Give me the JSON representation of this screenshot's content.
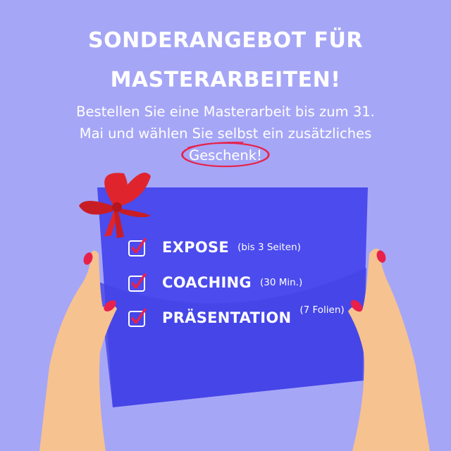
{
  "headline": {
    "line1": "SONDERANGEBOT FÜR",
    "line2": "MASTERARBEITEN!"
  },
  "subline": {
    "line1": "Bestellen Sie eine Masterarbeit bis zum 31.",
    "line2": "Mai und wählen Sie selbst ein zusätzliches",
    "highlight": "Geschenk!"
  },
  "items": [
    {
      "title": "EXPOSE",
      "note": "(bis 3 Seiten)"
    },
    {
      "title": "COACHING",
      "note": "(30 Min.)"
    },
    {
      "title": "PRÄSENTATION",
      "note": "(7 Folien)"
    }
  ],
  "colors": {
    "background": "#a6a6f7",
    "card": "#4b4bee",
    "ribbon": "#e0242d",
    "check": "#e8214a",
    "skin": "#f6c28f",
    "nails": "#e8214a"
  },
  "icons": [
    "ribbon-bow-icon",
    "checkbox-checked-icon",
    "hand-left-icon",
    "hand-right-icon"
  ]
}
